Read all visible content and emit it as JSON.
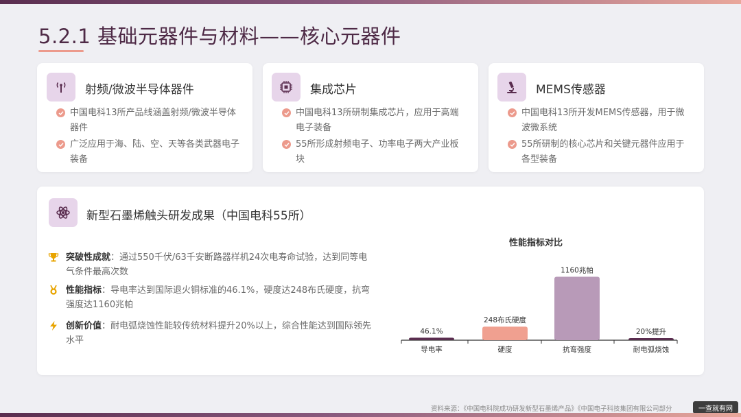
{
  "page": {
    "title": "5.2.1 基础元器件与材料——核心元器件",
    "source": "资料来源：《中国电科院成功研发新型石墨烯产品》《中国电子科技集团有限公司部分",
    "watermark": "一查就有网"
  },
  "cards": [
    {
      "title": "射频/微波半导体器件",
      "icon": "antenna-icon",
      "bullets": [
        "中国电科13所产品线涵盖射频/微波半导体器件",
        "广泛应用于海、陆、空、天等各类武器电子装备"
      ]
    },
    {
      "title": "集成芯片",
      "icon": "chip-icon",
      "bullets": [
        "中国电科13所研制集成芯片，应用于高端电子装备",
        "55所形成射频电子、功率电子两大产业板块"
      ]
    },
    {
      "title": "MEMS传感器",
      "icon": "microscope-icon",
      "bullets": [
        "中国电科13所开发MEMS传感器，用于微波微系统",
        "55所研制的核心芯片和关键元器件应用于各型装备"
      ]
    }
  ],
  "graphene": {
    "title": "新型石墨烯触头研发成果（中国电科55所）",
    "icon": "atom-icon",
    "features": [
      {
        "icon": "trophy-icon",
        "head": "突破性成就",
        "text": "：通过550千伏/63千安断路器样机24次电寿命试验，达到同等电气条件最高次数"
      },
      {
        "icon": "medal-icon",
        "head": "性能指标",
        "text": "：导电率达到国际退火铜标准的46.1%，硬度达248布氏硬度，抗弯强度达1160兆帕"
      },
      {
        "icon": "lightning-icon",
        "head": "创新价值",
        "text": "：耐电弧烧蚀性能较传统材料提升20%以上，综合性能达到国际领先水平"
      }
    ]
  },
  "colors": {
    "accent": "#ec9a8c",
    "primary": "#4e2a46",
    "icon_bg": "#e7d5ea",
    "bar_dark": "#5a2d4f",
    "bar_salmon": "#f0a090",
    "bar_mauve": "#b89ab8"
  },
  "chart_data": {
    "type": "bar",
    "title": "性能指标对比",
    "categories": [
      "导电率",
      "硬度",
      "抗弯强度",
      "耐电弧烧蚀"
    ],
    "values": [
      46.1,
      248,
      1160,
      20
    ],
    "data_labels": [
      "46.1%",
      "248布氏硬度",
      "1160兆帕",
      "20%提升"
    ],
    "ylim": [
      0,
      1300
    ],
    "grid": false,
    "legend": "none"
  }
}
